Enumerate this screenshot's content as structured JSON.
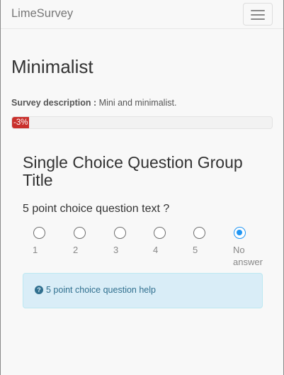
{
  "navbar": {
    "brand": "LimeSurvey",
    "toggle_icon": "hamburger-menu-icon"
  },
  "survey": {
    "title": "Minimalist",
    "description_label": "Survey description :",
    "description": "Mini and minimalist."
  },
  "progress": {
    "label": "-3%",
    "value_percent": -3,
    "color": "#c9302c"
  },
  "group": {
    "title": "Single Choice Question Group Title"
  },
  "question": {
    "text": "5 point choice question text ?",
    "options": [
      {
        "label": "1",
        "selected": false
      },
      {
        "label": "2",
        "selected": false
      },
      {
        "label": "3",
        "selected": false
      },
      {
        "label": "4",
        "selected": false
      },
      {
        "label": "5",
        "selected": false
      },
      {
        "label": "No answer",
        "selected": true
      }
    ],
    "accent_color": "#2196f3"
  },
  "help": {
    "icon": "question-circle-icon",
    "text": "5 point choice question help"
  }
}
